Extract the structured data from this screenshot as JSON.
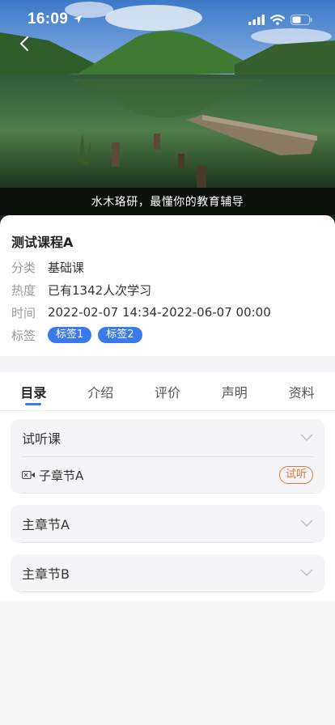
{
  "status_bar": {
    "time": "16:09"
  },
  "hero": {
    "caption": "水木珞研，最懂你的教育辅导"
  },
  "course": {
    "title": "测试课程A",
    "rows": [
      {
        "label": "分类",
        "value": "基础课"
      },
      {
        "label": "热度",
        "value": "已有1342人次学习"
      },
      {
        "label": "时间",
        "value": "2022-02-07 14:34-2022-06-07 00:00"
      }
    ],
    "tag_label": "标签",
    "tags": [
      "标签1",
      "标签2"
    ]
  },
  "tabs": [
    "目录",
    "介绍",
    "评价",
    "声明",
    "资料"
  ],
  "active_tab": "目录",
  "catalog": {
    "sections": [
      {
        "title": "试听课",
        "lessons": [
          {
            "title": "子章节A",
            "badge": "试听"
          }
        ]
      },
      {
        "title": "主章节A"
      },
      {
        "title": "主章节B"
      }
    ]
  },
  "colors": {
    "accent": "#3a7ae8",
    "trial": "#e0763a"
  }
}
